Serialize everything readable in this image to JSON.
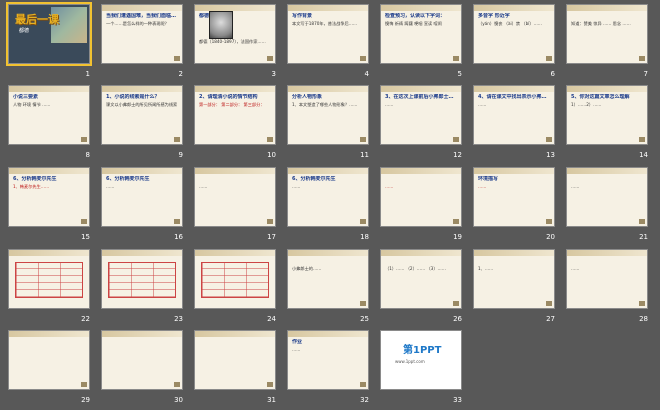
{
  "slides": [
    {
      "n": "1",
      "kind": "cover",
      "title": "最后一课",
      "sub": "都德",
      "selected": true
    },
    {
      "n": "2",
      "kind": "text",
      "title": "当我们遭遇国难，当我们面临敌寇的践踏时，也曾",
      "body": "一个……是怎么样的一种表现呢？"
    },
    {
      "n": "3",
      "kind": "portrait",
      "title": "都德",
      "body": "都德（1840-1897），法国作家……"
    },
    {
      "n": "4",
      "kind": "text",
      "title": "写作背景",
      "body": "本文写于1870年，普法战争后……"
    },
    {
      "n": "5",
      "kind": "text",
      "title": "检查预习，认读以下字词：",
      "body": "懊悔 祈祷 踌躇 哽咽 宣读 喧闹"
    },
    {
      "n": "6",
      "kind": "text",
      "title": "多音字 形近字",
      "body": "（yán）懊丧 （ài）禁 （bǐ）……"
    },
    {
      "n": "7",
      "kind": "text",
      "title": "",
      "body": "知道：赞美 惊异 …… 思念 ……"
    },
    {
      "n": "8",
      "kind": "text",
      "title": "小说三要素",
      "body": "人物 环境 情节 ……"
    },
    {
      "n": "9",
      "kind": "text",
      "title": "1、小说的线索是什么？",
      "body": "课文以小弗郎士的所见所闻所感为线索"
    },
    {
      "n": "10",
      "kind": "text",
      "title": "2、请理清小说的情节结构",
      "body": "第一部分： 第二部分： 第三部分：",
      "red": true
    },
    {
      "n": "11",
      "kind": "text",
      "title": "分析人物形象",
      "body": "1、本文塑造了哪些人物形象？……"
    },
    {
      "n": "12",
      "kind": "text",
      "title": "3、在这次上课前后小弗郎士的思想感情有什么变化",
      "body": "……"
    },
    {
      "n": "13",
      "kind": "text",
      "title": "4、请在课文中找出表示小弗郎士心理变化的句子",
      "body": "……"
    },
    {
      "n": "14",
      "kind": "text",
      "title": "5、你对这篇文章怎么理解",
      "body": "1）……2）……"
    },
    {
      "n": "15",
      "kind": "text",
      "title": "6、分析韩麦尔先生",
      "body": "1、韩麦尔先生……",
      "red": true
    },
    {
      "n": "16",
      "kind": "text",
      "title": "6、分析韩麦尔先生",
      "body": "……"
    },
    {
      "n": "17",
      "kind": "text",
      "title": "",
      "body": "……"
    },
    {
      "n": "18",
      "kind": "text",
      "title": "6、分析韩麦尔先生",
      "body": "……"
    },
    {
      "n": "19",
      "kind": "text",
      "title": "",
      "body": "……",
      "red": true
    },
    {
      "n": "20",
      "kind": "text",
      "title": "环境描写",
      "body": "……",
      "red": true
    },
    {
      "n": "21",
      "kind": "text",
      "title": "",
      "body": "……"
    },
    {
      "n": "22",
      "kind": "table",
      "title": "",
      "body": ""
    },
    {
      "n": "23",
      "kind": "table",
      "title": "",
      "body": ""
    },
    {
      "n": "24",
      "kind": "table",
      "title": "",
      "body": ""
    },
    {
      "n": "25",
      "kind": "text",
      "title": "",
      "body": "小弗郎士的……"
    },
    {
      "n": "26",
      "kind": "text",
      "title": "",
      "body": "（1）…… （2）…… （3）……"
    },
    {
      "n": "27",
      "kind": "text",
      "title": "",
      "body": "1、……"
    },
    {
      "n": "28",
      "kind": "text",
      "title": "",
      "body": "……"
    },
    {
      "n": "29",
      "kind": "text",
      "title": "",
      "body": ""
    },
    {
      "n": "30",
      "kind": "text",
      "title": "",
      "body": ""
    },
    {
      "n": "31",
      "kind": "text",
      "title": "",
      "body": ""
    },
    {
      "n": "32",
      "kind": "text",
      "title": "作业",
      "body": "……"
    },
    {
      "n": "33",
      "kind": "ppt",
      "title": "第1PPT",
      "body": "www.1ppt.com"
    }
  ]
}
